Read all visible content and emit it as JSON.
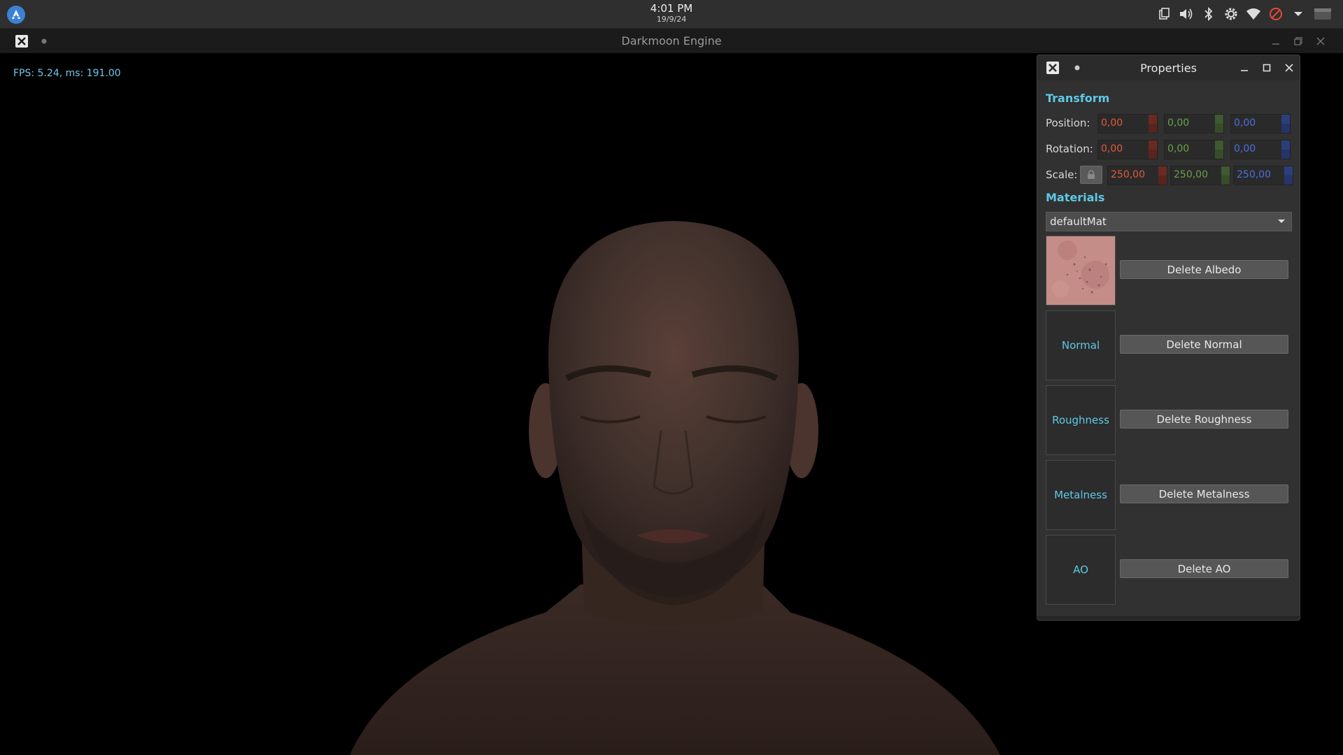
{
  "system_bar": {
    "time": "4:01 PM",
    "date": "19/9/24",
    "tray_icons": [
      "clipboard-icon",
      "volume-icon",
      "bluetooth-icon",
      "settings-icon",
      "wifi-icon",
      "no-sign-icon",
      "chevron-down-icon",
      "window-list-icon"
    ]
  },
  "window": {
    "title": "Darkmoon Engine"
  },
  "viewport": {
    "fps_text": "FPS: 5.24, ms: 191.00"
  },
  "properties": {
    "title": "Properties",
    "transform": {
      "heading": "Transform",
      "position_label": "Position:",
      "position": [
        "0,00",
        "0,00",
        "0,00"
      ],
      "rotation_label": "Rotation:",
      "rotation": [
        "0,00",
        "0,00",
        "0,00"
      ],
      "scale_label": "Scale:",
      "scale": [
        "250,00",
        "250,00",
        "250,00"
      ]
    },
    "materials": {
      "heading": "Materials",
      "selected": "defaultMat",
      "normal_label": "Normal",
      "roughness_label": "Roughness",
      "metalness_label": "Metalness",
      "ao_label": "AO",
      "delete_albedo": "Delete Albedo",
      "delete_normal": "Delete Normal",
      "delete_roughness": "Delete Roughness",
      "delete_metalness": "Delete Metalness",
      "delete_ao": "Delete AO"
    }
  },
  "colors": {
    "accent": "#5ec8e6",
    "x_axis": "#e05a3a",
    "y_axis": "#6aa04a",
    "z_axis": "#4a70e0"
  }
}
